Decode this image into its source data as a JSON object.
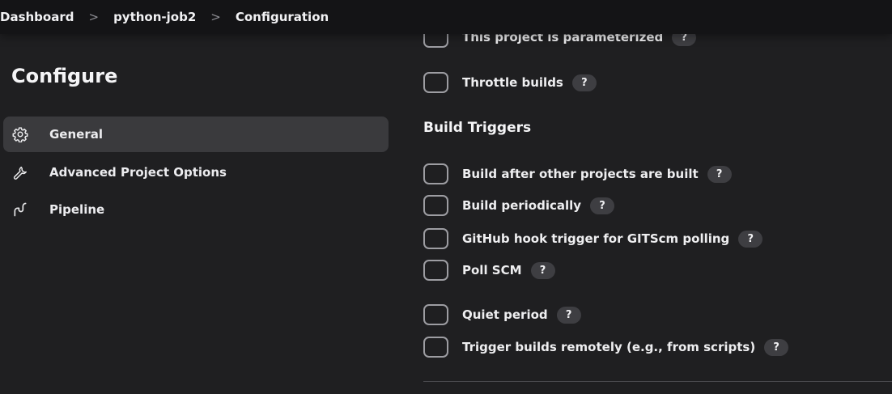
{
  "breadcrumb": {
    "items": [
      "Dashboard",
      "python-job2",
      "Configuration"
    ],
    "separator": ">"
  },
  "sidebar": {
    "title": "Configure",
    "items": [
      {
        "label": "General",
        "icon": "gear-icon",
        "active": true
      },
      {
        "label": "Advanced Project Options",
        "icon": "wrench-icon",
        "active": false
      },
      {
        "label": "Pipeline",
        "icon": "pipeline-icon",
        "active": false
      }
    ]
  },
  "main": {
    "general_options": [
      {
        "label": "This project is parameterized",
        "help": "?"
      },
      {
        "label": "Throttle builds",
        "help": "?"
      }
    ],
    "build_triggers": {
      "title": "Build Triggers",
      "options": [
        {
          "label": "Build after other projects are built",
          "help": "?"
        },
        {
          "label": "Build periodically",
          "help": "?"
        },
        {
          "label": "GitHub hook trigger for GITScm polling",
          "help": "?"
        },
        {
          "label": "Poll SCM",
          "help": "?"
        },
        {
          "label": "Quiet period",
          "help": "?"
        },
        {
          "label": "Trigger builds remotely (e.g., from scripts)",
          "help": "?"
        }
      ]
    }
  },
  "colors": {
    "background": "#1f1f21",
    "topbar": "#141416",
    "active_item": "#3a3a3d",
    "checkbox_border": "#9d9da2",
    "help_badge": "#3e3e42"
  }
}
